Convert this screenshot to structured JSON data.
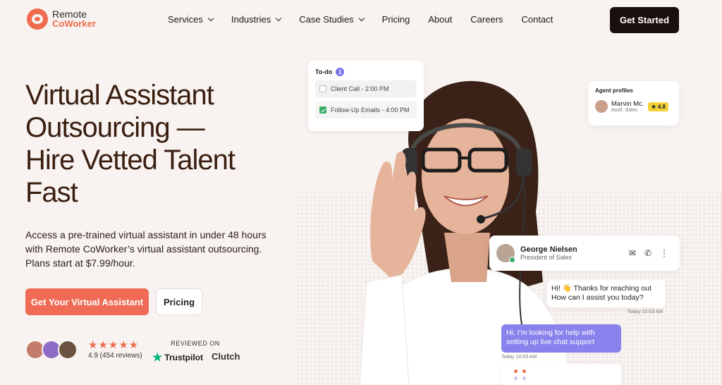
{
  "brand": {
    "line1": "Remote",
    "line2": "CoWorker"
  },
  "nav": {
    "items": [
      {
        "label": "Services",
        "dropdown": true
      },
      {
        "label": "Industries",
        "dropdown": true
      },
      {
        "label": "Case Studies",
        "dropdown": true
      },
      {
        "label": "Pricing",
        "dropdown": false
      },
      {
        "label": "About",
        "dropdown": false
      },
      {
        "label": "Careers",
        "dropdown": false
      },
      {
        "label": "Contact",
        "dropdown": false
      }
    ],
    "cta": "Get Started"
  },
  "hero": {
    "headline_lines": [
      "Virtual Assistant",
      "Outsourcing —",
      "Hire Vetted Talent",
      "Fast"
    ],
    "subtext_lines": [
      "Access a pre-trained virtual assistant in under 48 hours",
      "with Remote CoWorker’s virtual assistant outsourcing.",
      "Plans start at $7.99/hour."
    ],
    "primary_cta": "Get Your Virtual Assistant",
    "secondary_cta": "Pricing"
  },
  "social_proof": {
    "stars": "★★★★★",
    "rating_text": "4.9 (454 reviews)",
    "reviewed_on": "REVIEWED ON",
    "trustpilot": "Trustpilot",
    "clutch": "Clutch"
  },
  "todo": {
    "title": "To-do",
    "count": "1",
    "items": [
      {
        "label": "Client Call - 2:00 PM",
        "checked": false
      },
      {
        "label": "Follow-Up Emails - 4:00 PM",
        "checked": true
      }
    ]
  },
  "agent_profiles": {
    "title": "Agent profiles",
    "name": "Marvin Mc.",
    "role": "Asstt. Sales",
    "score": "★ 4.8"
  },
  "chat": {
    "contact_name": "George Nielsen",
    "contact_role": "President of Sales",
    "incoming": "Hi! 👋 Thanks for reaching out How can I assist you today?",
    "incoming_time": "Today 10:03 AM",
    "outgoing": "Hi, I’m looking for help with setting up live chat support",
    "outgoing_time": "Today 10:03 AM"
  },
  "colors": {
    "accent": "#ef6b55",
    "dark": "#1a0f0c",
    "chat_purple": "#8a82ec",
    "trustpilot_green": "#00b67a"
  }
}
